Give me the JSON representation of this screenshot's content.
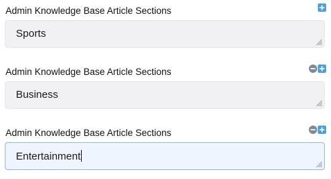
{
  "sections": [
    {
      "label": "Admin Knowledge Base Article Sections",
      "value": "Sports",
      "icons": [
        "plus-icon"
      ]
    },
    {
      "label": "Admin Knowledge Base Article Sections",
      "value": "Business",
      "icons": [
        "minus-icon",
        "plus-icon"
      ]
    },
    {
      "label": "Admin Knowledge Base Article Sections",
      "value": "Entertainment",
      "icons": [
        "minus-icon",
        "plus-icon"
      ],
      "focused": true
    }
  ],
  "colors": {
    "remove_icon": "#7f8a95",
    "add_icon": "#4a9fe6",
    "field_bg": "#f1f1f4",
    "field_focus_bg": "#eef5ff",
    "field_focus_border": "#93b8e3"
  }
}
